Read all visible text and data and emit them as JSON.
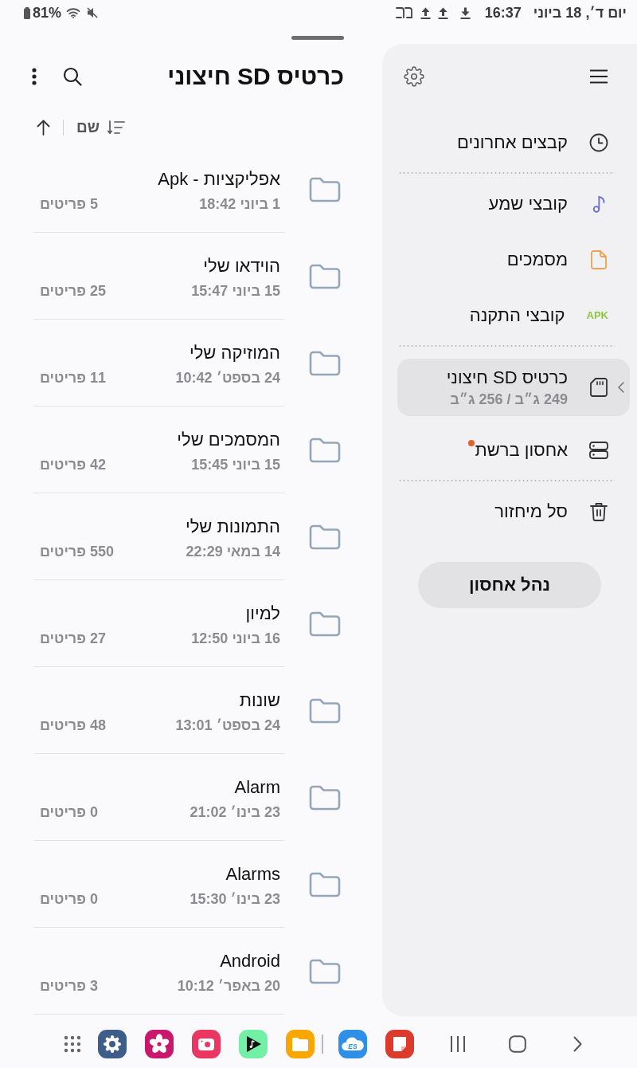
{
  "status_bar": {
    "battery": "81%",
    "time": "16:37",
    "date": "יום ד׳, 18 ביוני"
  },
  "file_panel": {
    "title": "כרטיס SD חיצוני",
    "sort": {
      "label": "שם",
      "ascending": true
    },
    "folders": [
      {
        "name": "אפליקציות - Apk",
        "modified": "1 ביוני 18:42",
        "count": "5 פריטים"
      },
      {
        "name": "הוידאו שלי",
        "modified": "15 ביוני 15:47",
        "count": "25 פריטים"
      },
      {
        "name": "המוזיקה שלי",
        "modified": "24 בספט׳ 10:42",
        "count": "11 פריטים"
      },
      {
        "name": "המסמכים שלי",
        "modified": "15 ביוני 15:45",
        "count": "42 פריטים"
      },
      {
        "name": "התמונות שלי",
        "modified": "14 במאי 22:29",
        "count": "550 פריטים"
      },
      {
        "name": "למיון",
        "modified": "16 ביוני 12:50",
        "count": "27 פריטים"
      },
      {
        "name": "שונות",
        "modified": "24 בספט׳ 13:01",
        "count": "48 פריטים"
      },
      {
        "name": "Alarm",
        "modified": "23 בינו׳ 21:02",
        "count": "0 פריטים"
      },
      {
        "name": "Alarms",
        "modified": "23 בינו׳ 15:30",
        "count": "0 פריטים"
      },
      {
        "name": "Android",
        "modified": "20 באפר׳ 10:12",
        "count": "3 פריטים"
      }
    ]
  },
  "sidebar": {
    "sections": [
      {
        "items": [
          {
            "kind": "recent",
            "label": "קבצים אחרונים",
            "selected": false,
            "expandable": false,
            "notification_dot": false
          }
        ]
      },
      {
        "items": [
          {
            "kind": "audio",
            "label": "קובצי שמע",
            "selected": false,
            "expandable": false,
            "notification_dot": false
          },
          {
            "kind": "documents",
            "label": "מסמכים",
            "selected": false,
            "expandable": false,
            "notification_dot": false
          },
          {
            "kind": "apk",
            "label": "קובצי התקנה",
            "icon_text": "APK",
            "selected": false,
            "expandable": false,
            "notification_dot": false
          }
        ]
      },
      {
        "items": [
          {
            "kind": "sd_card",
            "label": "כרטיס SD חיצוני",
            "subtitle": "249 ג״ב / 256 ג״ב",
            "selected": true,
            "expandable": true,
            "notification_dot": false
          },
          {
            "kind": "network",
            "label": "אחסון ברשת",
            "selected": false,
            "expandable": false,
            "notification_dot": true
          }
        ]
      },
      {
        "items": [
          {
            "kind": "trash",
            "label": "סל מיחזור",
            "selected": false,
            "expandable": false,
            "notification_dot": false
          }
        ]
      }
    ],
    "button": "נהל אחסון"
  },
  "dock": {
    "pinned_apps": [
      {
        "kind": "settings"
      },
      {
        "kind": "gallery"
      },
      {
        "kind": "camera"
      },
      {
        "kind": "music"
      },
      {
        "kind": "files"
      }
    ],
    "recent_apps": [
      {
        "kind": "explorer",
        "logo_text": "ES"
      },
      {
        "kind": "notes"
      }
    ]
  }
}
